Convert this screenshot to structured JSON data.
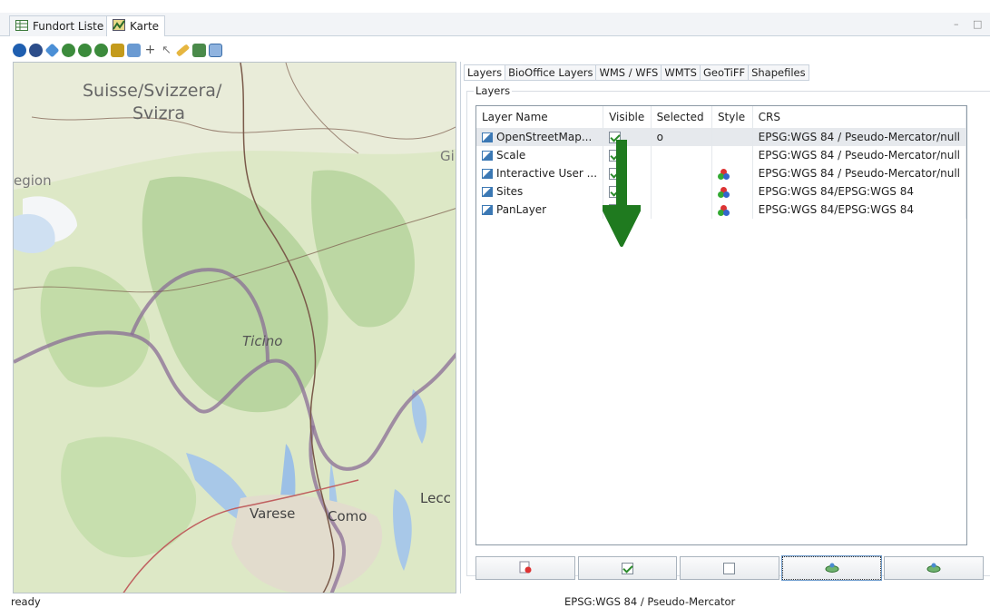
{
  "top_tabs": [
    {
      "label": "Fundort Liste",
      "icon": "table-icon"
    },
    {
      "label": "Karte",
      "icon": "map-icon"
    }
  ],
  "toolbar_icons": [
    "info-icon",
    "wkt-icon",
    "pan-icon",
    "zoom-icon",
    "zoom-in-icon",
    "zoom-out-icon",
    "layer-icon",
    "select-icon",
    "crosshair-icon",
    "pointer-icon",
    "measure-icon",
    "export-icon",
    "window-icon"
  ],
  "map": {
    "labels": [
      "Suisse/Svizzera/",
      "Svizra",
      "egion",
      "Ticino",
      "Varese",
      "Como",
      "Lecc",
      "Gi"
    ]
  },
  "right_tabs": [
    "Layers",
    "BioOffice Layers",
    "WMS / WFS",
    "WMTS",
    "GeoTiFF",
    "Shapefiles"
  ],
  "group_label": "Layers",
  "table": {
    "headers": [
      "Layer Name",
      "Visible",
      "Selected",
      "Style",
      "CRS"
    ],
    "rows": [
      {
        "name": "OpenStreetMap...",
        "visible": true,
        "selected": "o",
        "style": false,
        "crs": "EPSG:WGS 84 / Pseudo-Mercator/null"
      },
      {
        "name": "Scale",
        "visible": true,
        "selected": "",
        "style": false,
        "crs": "EPSG:WGS 84 / Pseudo-Mercator/null"
      },
      {
        "name": "Interactive User ...",
        "visible": true,
        "selected": "",
        "style": true,
        "crs": "EPSG:WGS 84 / Pseudo-Mercator/null"
      },
      {
        "name": "Sites",
        "visible": true,
        "selected": "",
        "style": true,
        "crs": "EPSG:WGS 84/EPSG:WGS 84"
      },
      {
        "name": "PanLayer",
        "visible": false,
        "selected": "",
        "style": true,
        "crs": "EPSG:WGS 84/EPSG:WGS 84"
      }
    ]
  },
  "bottom_buttons": [
    "remove-layer-icon",
    "check-all-icon",
    "uncheck-all-icon",
    "style-layer-icon",
    "style-layer-icon"
  ],
  "status": {
    "left": "ready",
    "crs": "EPSG:WGS 84 / Pseudo-Mercator"
  },
  "colors": {
    "arrow": "#1f7a1f",
    "check": "#2a8a2a",
    "selected_row": "#e6e9ed"
  }
}
